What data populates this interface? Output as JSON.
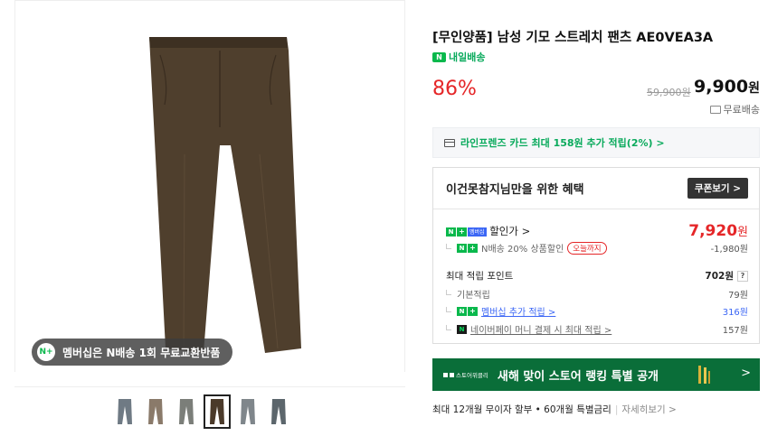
{
  "product": {
    "title": "[무인양품] 남성 기모 스트레치 팬츠 AE0VEA3A",
    "delivery_badge": "N",
    "delivery_label": "내일배송",
    "discount": "86%",
    "original_price": "59,900원",
    "sale_price": "9,900",
    "sale_currency": "원",
    "free_shipping": "무료배송"
  },
  "gallery": {
    "membership_pill": "멤버십은 N배송 1회 무료교환반품",
    "pill_icon_text": "N+",
    "thumbnails": [
      {
        "color": "#6f7a84",
        "active": false
      },
      {
        "color": "#8a7a6a",
        "active": false
      },
      {
        "color": "#7b7e79",
        "active": false
      },
      {
        "color": "#4b3a2a",
        "active": true
      },
      {
        "color": "#7f868b",
        "active": false
      },
      {
        "color": "#5c666c",
        "active": false
      }
    ],
    "main_color": "#4f3f2d"
  },
  "card_promo": "라인프렌즈 카드 최대 158원 추가 적립(2%) >",
  "benefits": {
    "title": "이건못참지님만을 위한 혜택",
    "coupon_button": "쿠폰보기 >",
    "discount_label": "할인가 >",
    "discount_price": "7,920",
    "discount_currency": "원",
    "n_discount_label": "N배송 20% 상품할인",
    "today_tag": "오늘까지",
    "n_discount_value": "-1,980원",
    "max_points_label": "최대 적립 포인트",
    "max_points_value": "702원",
    "question_mark": "?",
    "basic_label": "기본적립",
    "basic_value": "79원",
    "membership_label": "멤버십 추가 적립 >",
    "membership_value": "316원",
    "naverpay_label": "네이버페이 머니 결제 시 최대 적립 >",
    "naverpay_value": "157원",
    "badge_n": "N",
    "badge_plus": "+",
    "badge_membership": "멤버십",
    "badge_pay": "N"
  },
  "banner": {
    "brand": "스토어위클리",
    "text": "새해 맞이 스토어 랭킹 특별 공개",
    "arrow": ">",
    "color": "#0a6e39"
  },
  "installment": {
    "text": "최대 12개월 무이자 할부 • 60개월 특별금리",
    "separator": "|",
    "more": "자세히보기 >"
  }
}
